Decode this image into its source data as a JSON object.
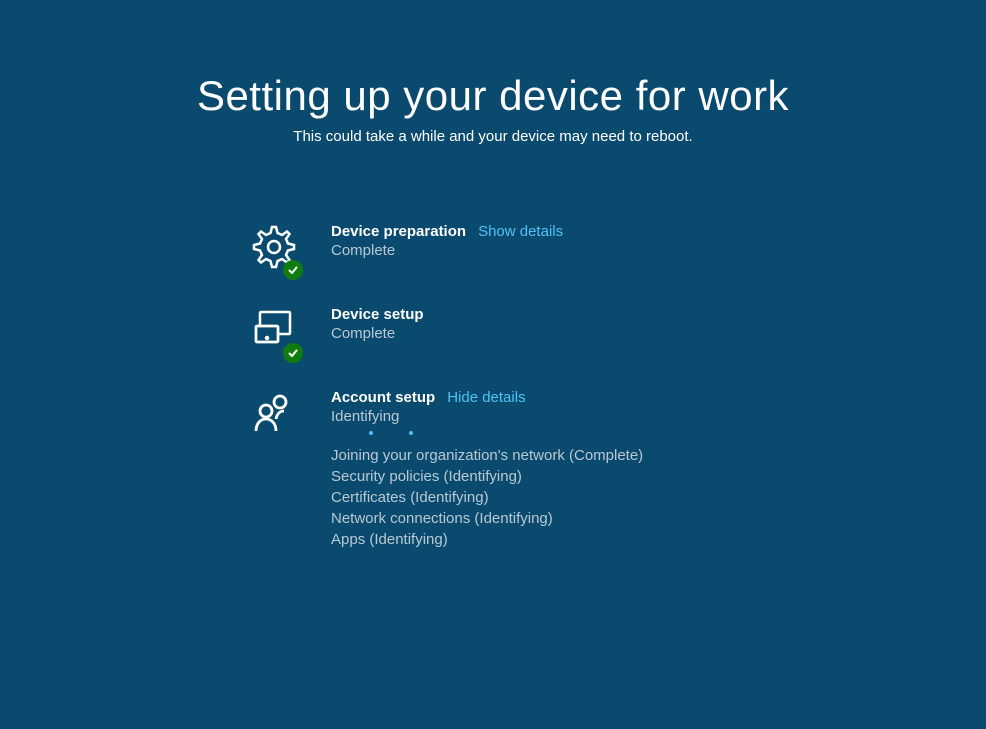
{
  "header": {
    "title": "Setting up your device for work",
    "subtitle": "This could take a while and your device may need to reboot."
  },
  "steps": {
    "device_preparation": {
      "title": "Device preparation",
      "details_link": "Show details",
      "status": "Complete"
    },
    "device_setup": {
      "title": "Device setup",
      "status": "Complete"
    },
    "account_setup": {
      "title": "Account setup",
      "details_link": "Hide details",
      "status": "Identifying",
      "details": [
        "Joining your organization's network (Complete)",
        "Security policies (Identifying)",
        "Certificates (Identifying)",
        "Network connections (Identifying)",
        "Apps (Identifying)"
      ]
    }
  }
}
